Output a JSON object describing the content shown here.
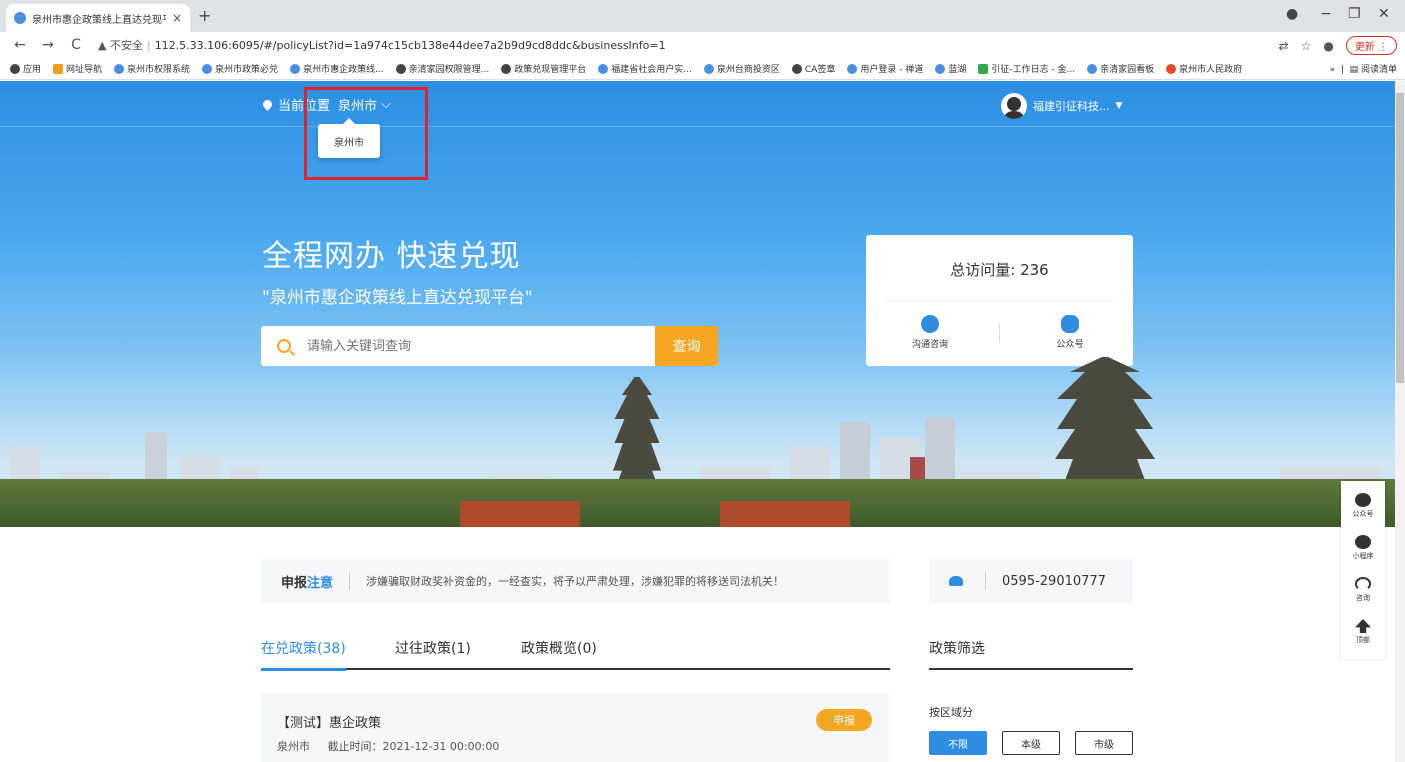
{
  "browser": {
    "tab_title": "泉州市惠企政策线上直达兑现平台",
    "new_tab": "+",
    "url_warning": "▲ 不安全",
    "url": "112.5.33.106:6095/#/policyList?id=1a974c15cb138e44dee7a2b9d9cd8ddc&businessInfo=1",
    "update_label": "更新",
    "bookmarks": [
      "应用",
      "网址导航",
      "泉州市权限系统",
      "泉州市政策必兑",
      "泉州市惠企政策线...",
      "亲清家园权限管理...",
      "政策兑现管理平台",
      "福建省社会用户实...",
      "泉州台商投资区",
      "CA签章",
      "用户登录 - 禅道",
      "蓝湖",
      "引征-工作日志 - 金...",
      "亲清家园看板",
      "泉州市人民政府"
    ],
    "bookmarks_more": "»",
    "reading_list": "阅读清单"
  },
  "header": {
    "location_label": "当前位置",
    "city": "泉州市",
    "dropdown_option": "泉州市",
    "user_name": "福建引征科技..."
  },
  "hero": {
    "slogan": "全程网办 快速兑现",
    "subslogan": "\"泉州市惠企政策线上直达兑现平台\"",
    "search_placeholder": "请输入关键词查询",
    "search_button": "查询",
    "visit_total": "总访问量: 236",
    "consult_label": "沟通咨询",
    "wechat_label": "公众号"
  },
  "notice": {
    "label_main": "申报",
    "label_accent": "注意",
    "text": "涉嫌骗取财政奖补资金的，一经查实，将予以严肃处理，涉嫌犯罪的将移送司法机关！"
  },
  "phone": "0595-29010777",
  "tabs": [
    "在兑政策(38)",
    "过往政策(1)",
    "政策概览(0)"
  ],
  "filter": {
    "title": "政策筛选",
    "region_label": "按区域分",
    "options": [
      "不限",
      "本级",
      "市级"
    ]
  },
  "policy": {
    "name": "【测试】惠企政策",
    "city": "泉州市",
    "deadline": "截止时间：2021-12-31 00:00:00",
    "apply_button": "申报"
  },
  "floating": [
    "公众号",
    "小程序",
    "咨询",
    "顶部"
  ],
  "colors": {
    "accent_blue": "#2e8de0",
    "accent_orange": "#f5a623",
    "highlight_red": "#e0242b"
  }
}
